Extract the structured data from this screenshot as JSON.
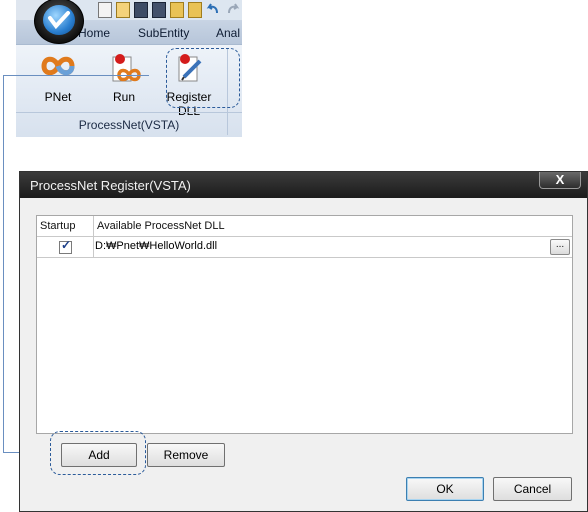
{
  "ribbon": {
    "tabs": [
      "Home",
      "SubEntity",
      "Anal"
    ],
    "buttons": [
      {
        "label": "PNet",
        "icon": "pnet-icon"
      },
      {
        "label": "Run",
        "icon": "run-icon"
      },
      {
        "label": "Register DLL",
        "icon": "register-dll-icon"
      }
    ],
    "group_title": "ProcessNet(VSTA)"
  },
  "dialog": {
    "title": "ProcessNet Register(VSTA)",
    "close_glyph": "X",
    "columns": [
      "Startup",
      "Available ProcessNet DLL"
    ],
    "rows": [
      {
        "startup": true,
        "path": "D:₩Pnet₩HelloWorld.dll",
        "browse_label": "..."
      }
    ],
    "buttons": {
      "add": "Add",
      "remove": "Remove",
      "ok": "OK",
      "cancel": "Cancel"
    }
  },
  "colors": {
    "accent": "#2b5b9a",
    "titlebar": "#1b1b1b",
    "connector": "#6a8fc0"
  }
}
